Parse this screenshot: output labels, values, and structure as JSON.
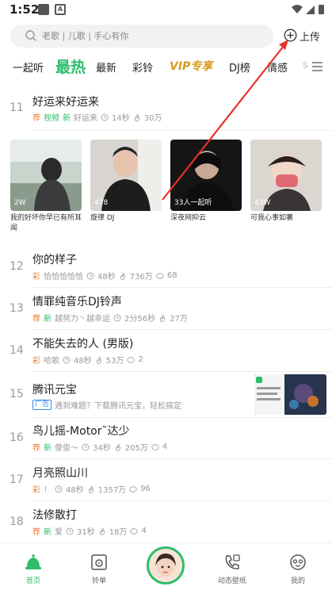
{
  "status_bar": {
    "time": "1:52"
  },
  "search": {
    "placeholder": "老歌 | 儿歌 | 手心有你"
  },
  "upload": {
    "label": "上传"
  },
  "tabs": [
    {
      "label": "一起听"
    },
    {
      "label": "最热"
    },
    {
      "label": "最新"
    },
    {
      "label": "彩铃"
    },
    {
      "label": "VIP专享"
    },
    {
      "label": "DJ榜"
    },
    {
      "label": "情感"
    },
    {
      "label": "s"
    }
  ],
  "songs": [
    {
      "num": "11",
      "title": "好运来好运来",
      "tags": [
        "荐",
        "视频",
        "新"
      ],
      "artist": "好运来",
      "duration": "14秒",
      "plays": "30万",
      "comments": ""
    },
    {
      "num": "12",
      "title": "你的样子",
      "tags": [
        "彩"
      ],
      "artist": "恰恰恰恰恰",
      "duration": "48秒",
      "plays": "736万",
      "comments": "68"
    },
    {
      "num": "13",
      "title": "情罪纯音乐DJ铃声",
      "tags": [
        "荐",
        "新"
      ],
      "artist": "越努力丶越幸运",
      "duration": "2分56秒",
      "plays": "27万",
      "comments": ""
    },
    {
      "num": "14",
      "title": "不能失去的人 (男版)",
      "tags": [
        "彩"
      ],
      "artist": "哈歌",
      "duration": "48秒",
      "plays": "53万",
      "comments": "2"
    },
    {
      "num": "15",
      "title": "腾讯元宝",
      "tags": [
        "广告"
      ],
      "artist": "遇到难题？下载腾讯元宝，轻松搞定",
      "duration": "",
      "plays": "",
      "comments": ""
    },
    {
      "num": "16",
      "title": "鸟儿摇-Motor˜达少",
      "tags": [
        "荐",
        "新"
      ],
      "artist": "傻俊～",
      "duration": "34秒",
      "plays": "205万",
      "comments": "4"
    },
    {
      "num": "17",
      "title": "月亮照山川",
      "tags": [
        "彩"
      ],
      "artist": "！",
      "duration": "48秒",
      "plays": "1357万",
      "comments": "96"
    },
    {
      "num": "18",
      "title": "法修散打",
      "tags": [
        "荐",
        "新"
      ],
      "artist": "爱",
      "duration": "31秒",
      "plays": "18万",
      "comments": "4"
    }
  ],
  "video_cards": [
    {
      "badge": "2W",
      "caption": "我的好坏你早已有所耳闻"
    },
    {
      "badge": "478",
      "caption": "旋律 DJ"
    },
    {
      "badge": "33人一起听",
      "caption": "深夜网抑云"
    },
    {
      "badge": "43W",
      "caption": "可我心事如薯"
    }
  ],
  "bottom_nav": [
    {
      "label": "首页"
    },
    {
      "label": "铃单"
    },
    {
      "label": "动态壁纸"
    },
    {
      "label": "我的"
    }
  ],
  "colors": {
    "accent": "#2dbd6b",
    "recommend": "#f27b2c",
    "vip": "#d89a1c",
    "annotation_arrow": "#e8302a"
  }
}
